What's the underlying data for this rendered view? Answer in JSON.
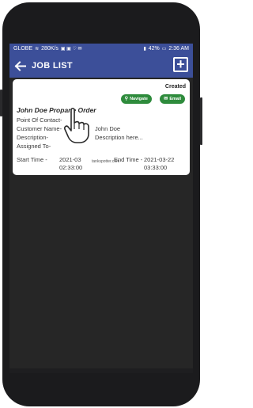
{
  "status_bar": {
    "carrier": "GLOBE",
    "speed": "280K/s",
    "battery": "42%",
    "time": "2:36 AM"
  },
  "app_bar": {
    "title": "JOB LIST",
    "add_label": "+"
  },
  "job": {
    "status": "Created",
    "navigate_label": "Navigate",
    "email_label": "Email",
    "title": "John Doe Propane Order",
    "point_of_contact_label": "Point Of Contact-",
    "customer_name_label": "Customer Name-",
    "customer_name_value": "John Doe",
    "description_label": "Description-",
    "description_value": "Description here...",
    "assigned_to_label": "Assigned To-",
    "site": "tankspotter.com",
    "start_time_label": "Start Time -",
    "start_date": "2021-03",
    "start_clock": "02:33:00",
    "end_time_label": "End Time -",
    "end_date": "2021-03-22",
    "end_clock": "03:33:00"
  },
  "icons": {
    "back": "back-arrow-icon",
    "add": "add-icon",
    "navigate": "location-pin-icon",
    "email": "email-icon",
    "pointer": "hand-pointer-icon"
  },
  "colors": {
    "app_bar": "#3c4f99",
    "pill_green": "#2e8b3c",
    "screen_bg": "#262626"
  }
}
